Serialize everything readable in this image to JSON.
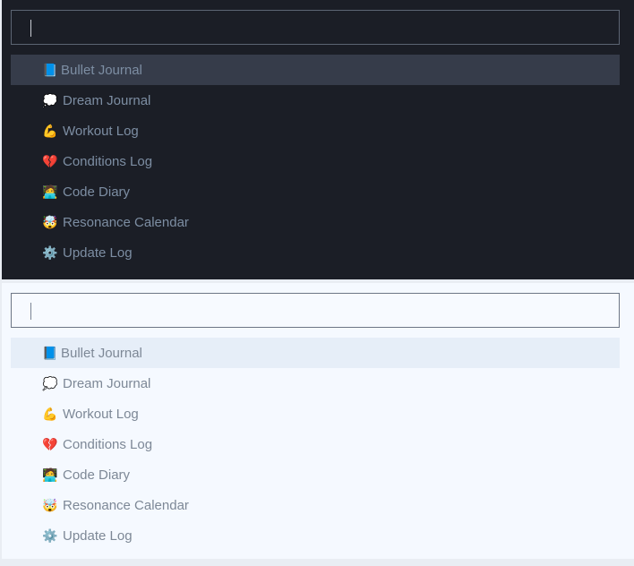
{
  "themes": [
    "dark",
    "light"
  ],
  "search": {
    "value": ""
  },
  "items": [
    {
      "icon": "📘",
      "icon_name": "blue-book-icon",
      "label": "Bullet Journal",
      "selected": true
    },
    {
      "icon": "💭",
      "icon_name": "thought-balloon-icon",
      "label": "Dream Journal"
    },
    {
      "icon": "💪",
      "icon_name": "flexed-biceps-icon",
      "label": "Workout Log"
    },
    {
      "icon": "💔",
      "icon_name": "broken-heart-icon",
      "label": "Conditions Log"
    },
    {
      "icon": "🧑‍💻",
      "icon_name": "technologist-icon",
      "label": "Code Diary"
    },
    {
      "icon": "🤯",
      "icon_name": "exploding-head-icon",
      "label": "Resonance Calendar"
    },
    {
      "icon": "⚙️",
      "icon_name": "gear-icon",
      "label": "Update Log"
    }
  ]
}
